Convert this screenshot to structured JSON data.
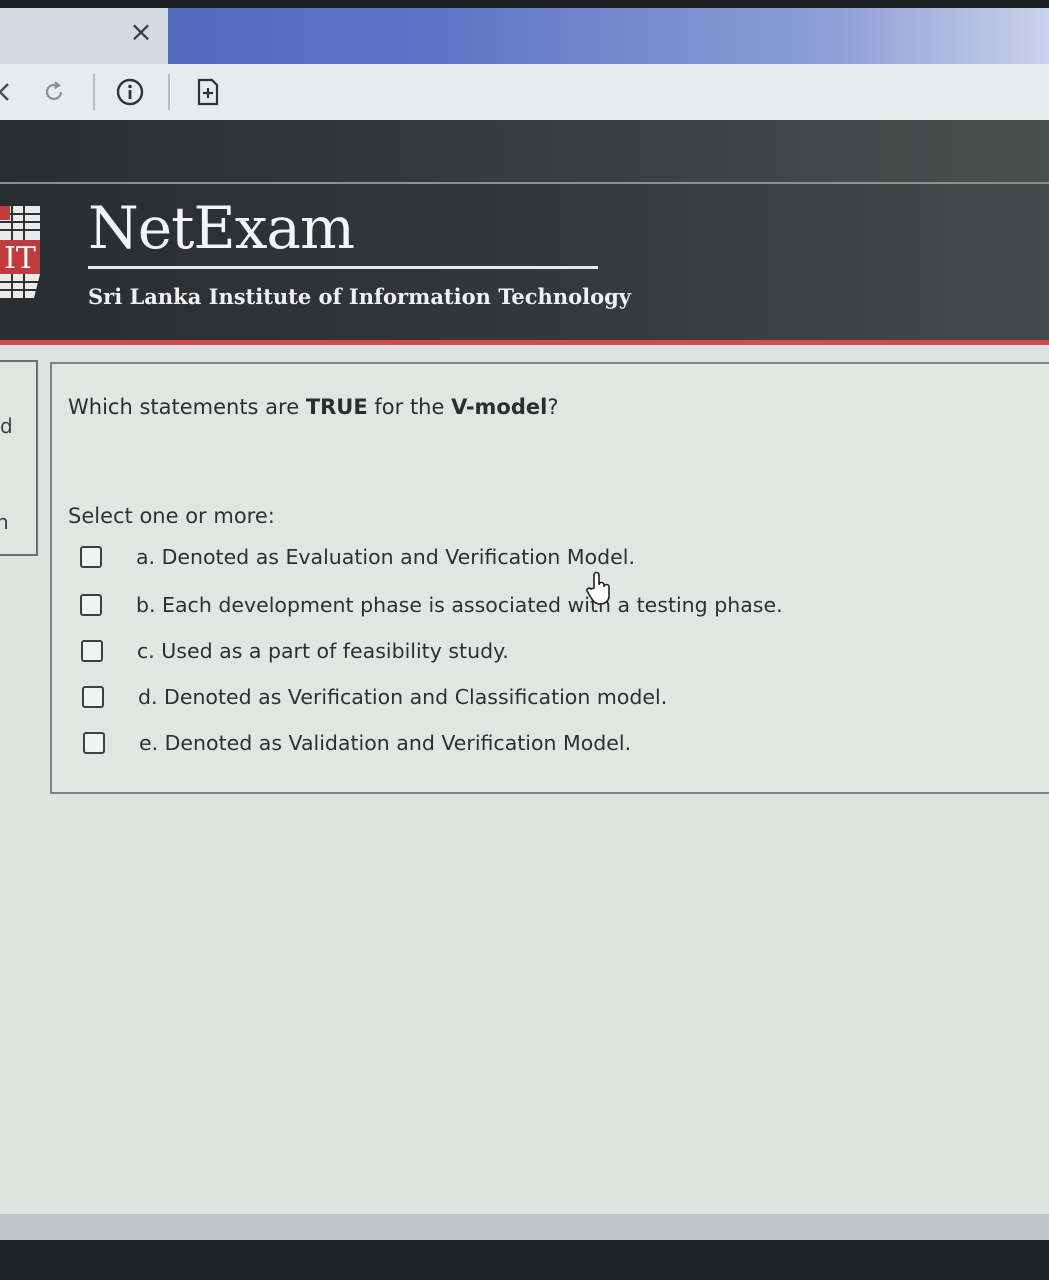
{
  "browser": {
    "tab_close_glyph": "×"
  },
  "header": {
    "brand_title": "NetExam",
    "brand_subtitle": "Sri Lanka Institute of Information Technology",
    "accent_color": "#d24a4c"
  },
  "sidebar": {
    "fragment_1": "d",
    "fragment_2": "n"
  },
  "question": {
    "text_prefix": "Which statements are ",
    "text_bold_1": "TRUE",
    "text_middle": " for the ",
    "text_bold_2": "V-model",
    "text_suffix": "?",
    "select_prompt": "Select one or more:",
    "options": [
      {
        "label": "a. Denoted as Evaluation and Verification Model.",
        "checked": false
      },
      {
        "label": "b. Each development phase is associated with a testing phase.",
        "checked": false
      },
      {
        "label": "c. Used as a part of feasibility study.",
        "checked": false
      },
      {
        "label": "d. Denoted as Verification and Classification model.",
        "checked": false
      },
      {
        "label": "e. Denoted as Validation and Verification Model.",
        "checked": false
      }
    ]
  },
  "icons": {
    "tab_close": "close-icon",
    "reload": "reload-icon",
    "info": "info-icon",
    "page_action": "page-action-icon",
    "cursor": "hand-cursor-icon"
  }
}
